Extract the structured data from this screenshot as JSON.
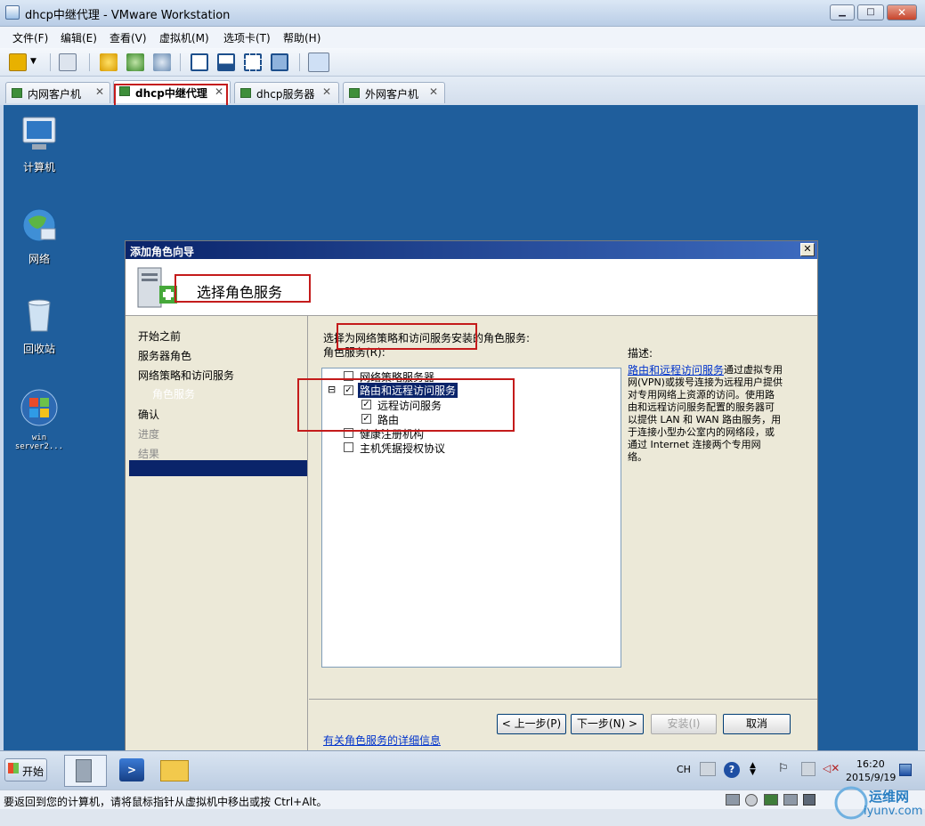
{
  "window": {
    "title": "dhcp中继代理 - VMware Workstation",
    "controls": {
      "minimize": "▁",
      "maximize": "□",
      "close": "✕"
    }
  },
  "menu": [
    "文件(F)",
    "编辑(E)",
    "查看(V)",
    "虚拟机(M)",
    "选项卡(T)",
    "帮助(H)"
  ],
  "tabs": [
    {
      "label": "内网客户机",
      "close": "✕"
    },
    {
      "label": "dhcp中继代理",
      "close": "✕"
    },
    {
      "label": "dhcp服务器",
      "close": "✕"
    },
    {
      "label": "外网客户机",
      "close": "✕"
    }
  ],
  "desktop_icons": [
    "计算机",
    "网络",
    "回收站",
    "win server2..."
  ],
  "wizard": {
    "title": "添加角色向导",
    "close": "✕",
    "header": "选择角色服务",
    "nav": [
      "开始之前",
      "服务器角色",
      "网络策略和访问服务",
      "角色服务",
      "确认",
      "进度",
      "结果"
    ],
    "prompt": "选择为网络策略和访问服务安装的角色服务:",
    "role_services_label": "角色服务(R):",
    "tree": [
      {
        "label": "网络策略服务器",
        "checked": false
      },
      {
        "label": "路由和远程访问服务",
        "checked": true,
        "expander": "⊟"
      },
      {
        "label": "远程访问服务",
        "checked": true
      },
      {
        "label": "路由",
        "checked": true
      },
      {
        "label": "健康注册机构",
        "checked": false
      },
      {
        "label": "主机凭据授权协议",
        "checked": false
      }
    ],
    "checkmark": "✓",
    "description_label": "描述:",
    "description_link": "路由和远程访问服务",
    "description_lines": [
      "通过虚拟专用",
      "网(VPN)或拨号连接为远程用户提供",
      "对专用网络上资源的访问。使用路",
      "由和远程访问服务配置的服务器可",
      "以提供 LAN 和 WAN 路由服务，用",
      "于连接小型办公室内的网络段，或",
      "通过 Internet 连接两个专用网",
      "络。"
    ],
    "more_info_link": "有关角色服务的详细信息",
    "buttons": {
      "back": "< 上一步(P)",
      "next": "下一步(N) >",
      "install": "安装(I)",
      "cancel": "取消"
    }
  },
  "taskbar": {
    "start": "开始",
    "lang": "CH",
    "time": "16:20",
    "date": "2015/9/19"
  },
  "status": "要返回到您的计算机，请将鼠标指针从虚拟机中移出或按 Ctrl+Alt。",
  "watermark": {
    "line1": "运维网",
    "line2": "iyunv.com"
  },
  "colors": {
    "desktop": "#1f5e9c",
    "selection": "#0a246a",
    "annotation": "#c41b1b"
  }
}
